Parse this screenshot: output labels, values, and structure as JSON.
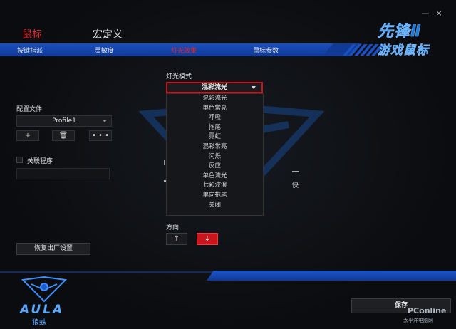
{
  "window": {
    "min_glyph": "—",
    "close_glyph": "×"
  },
  "top_tabs": {
    "mouse": "鼠标",
    "macro": "宏定义"
  },
  "nav": {
    "items": [
      {
        "label": "按键指派",
        "active": false
      },
      {
        "label": "灵敏度",
        "active": false
      },
      {
        "label": "灯光效果",
        "active": true
      },
      {
        "label": "鼠标参数",
        "active": false
      }
    ]
  },
  "logo": {
    "line1": "先锋Ⅱ",
    "line2": "游戏鼠标"
  },
  "profile": {
    "label": "配置文件",
    "selected": "Profile1",
    "add": "+",
    "delete": "🗑",
    "more": "• • •"
  },
  "link_program": {
    "label": "关联程序"
  },
  "reset": {
    "label": "恢复出厂设置"
  },
  "light_mode": {
    "label": "灯光模式",
    "selected": "混彩流光",
    "options": [
      "混彩流光",
      "单色常亮",
      "呼吸",
      "拖尾",
      "霓虹",
      "混彩常亮",
      "闪烁",
      "反应",
      "单色流光",
      "七彩波浪",
      "单向拖尾",
      "关闭"
    ]
  },
  "speed": {
    "fast_label": "快"
  },
  "direction": {
    "label": "方向",
    "up": "↑",
    "down": "↓"
  },
  "brand": {
    "name": "AULA",
    "sub": "狼蛛"
  },
  "save": {
    "label": "保存"
  },
  "watermark": {
    "main": "PConline",
    "sub": "太平洋电脑网"
  },
  "colors": {
    "accent_red": "#c8161c",
    "nav_blue": "#1b4fbf",
    "logo_blue": "#1d7ad6"
  }
}
